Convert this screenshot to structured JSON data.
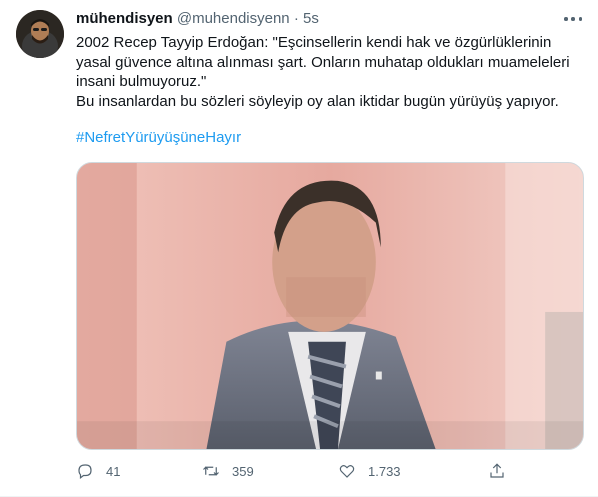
{
  "tweet": {
    "author_name": "mühendisyen",
    "handle": "@muhendisyenn",
    "separator": "·",
    "time": "5s",
    "text_lines": [
      "2002 Recep Tayyip Erdoğan: \"Eşcinsellerin kendi hak ve özgürlüklerinin",
      "yasal güvence altına alınması şart. Onların muhatap oldukları muameleleri",
      "insani bulmuyoruz.\"",
      "Bu insanlardan bu sözleri söyleyip oy alan iktidar bugün yürüyüş yapıyor."
    ],
    "hashtag": "#NefretYürüyüşüneHayır",
    "actions": {
      "reply_count": "41",
      "retweet_count": "359",
      "like_count": "1.733"
    }
  },
  "icons": {
    "more": "more-horizontal-icon",
    "reply": "reply-icon",
    "retweet": "retweet-icon",
    "like": "heart-icon",
    "share": "share-icon"
  },
  "colors": {
    "link": "#1d9bf0",
    "secondary_text": "#536471",
    "primary_text": "#0f1419"
  }
}
